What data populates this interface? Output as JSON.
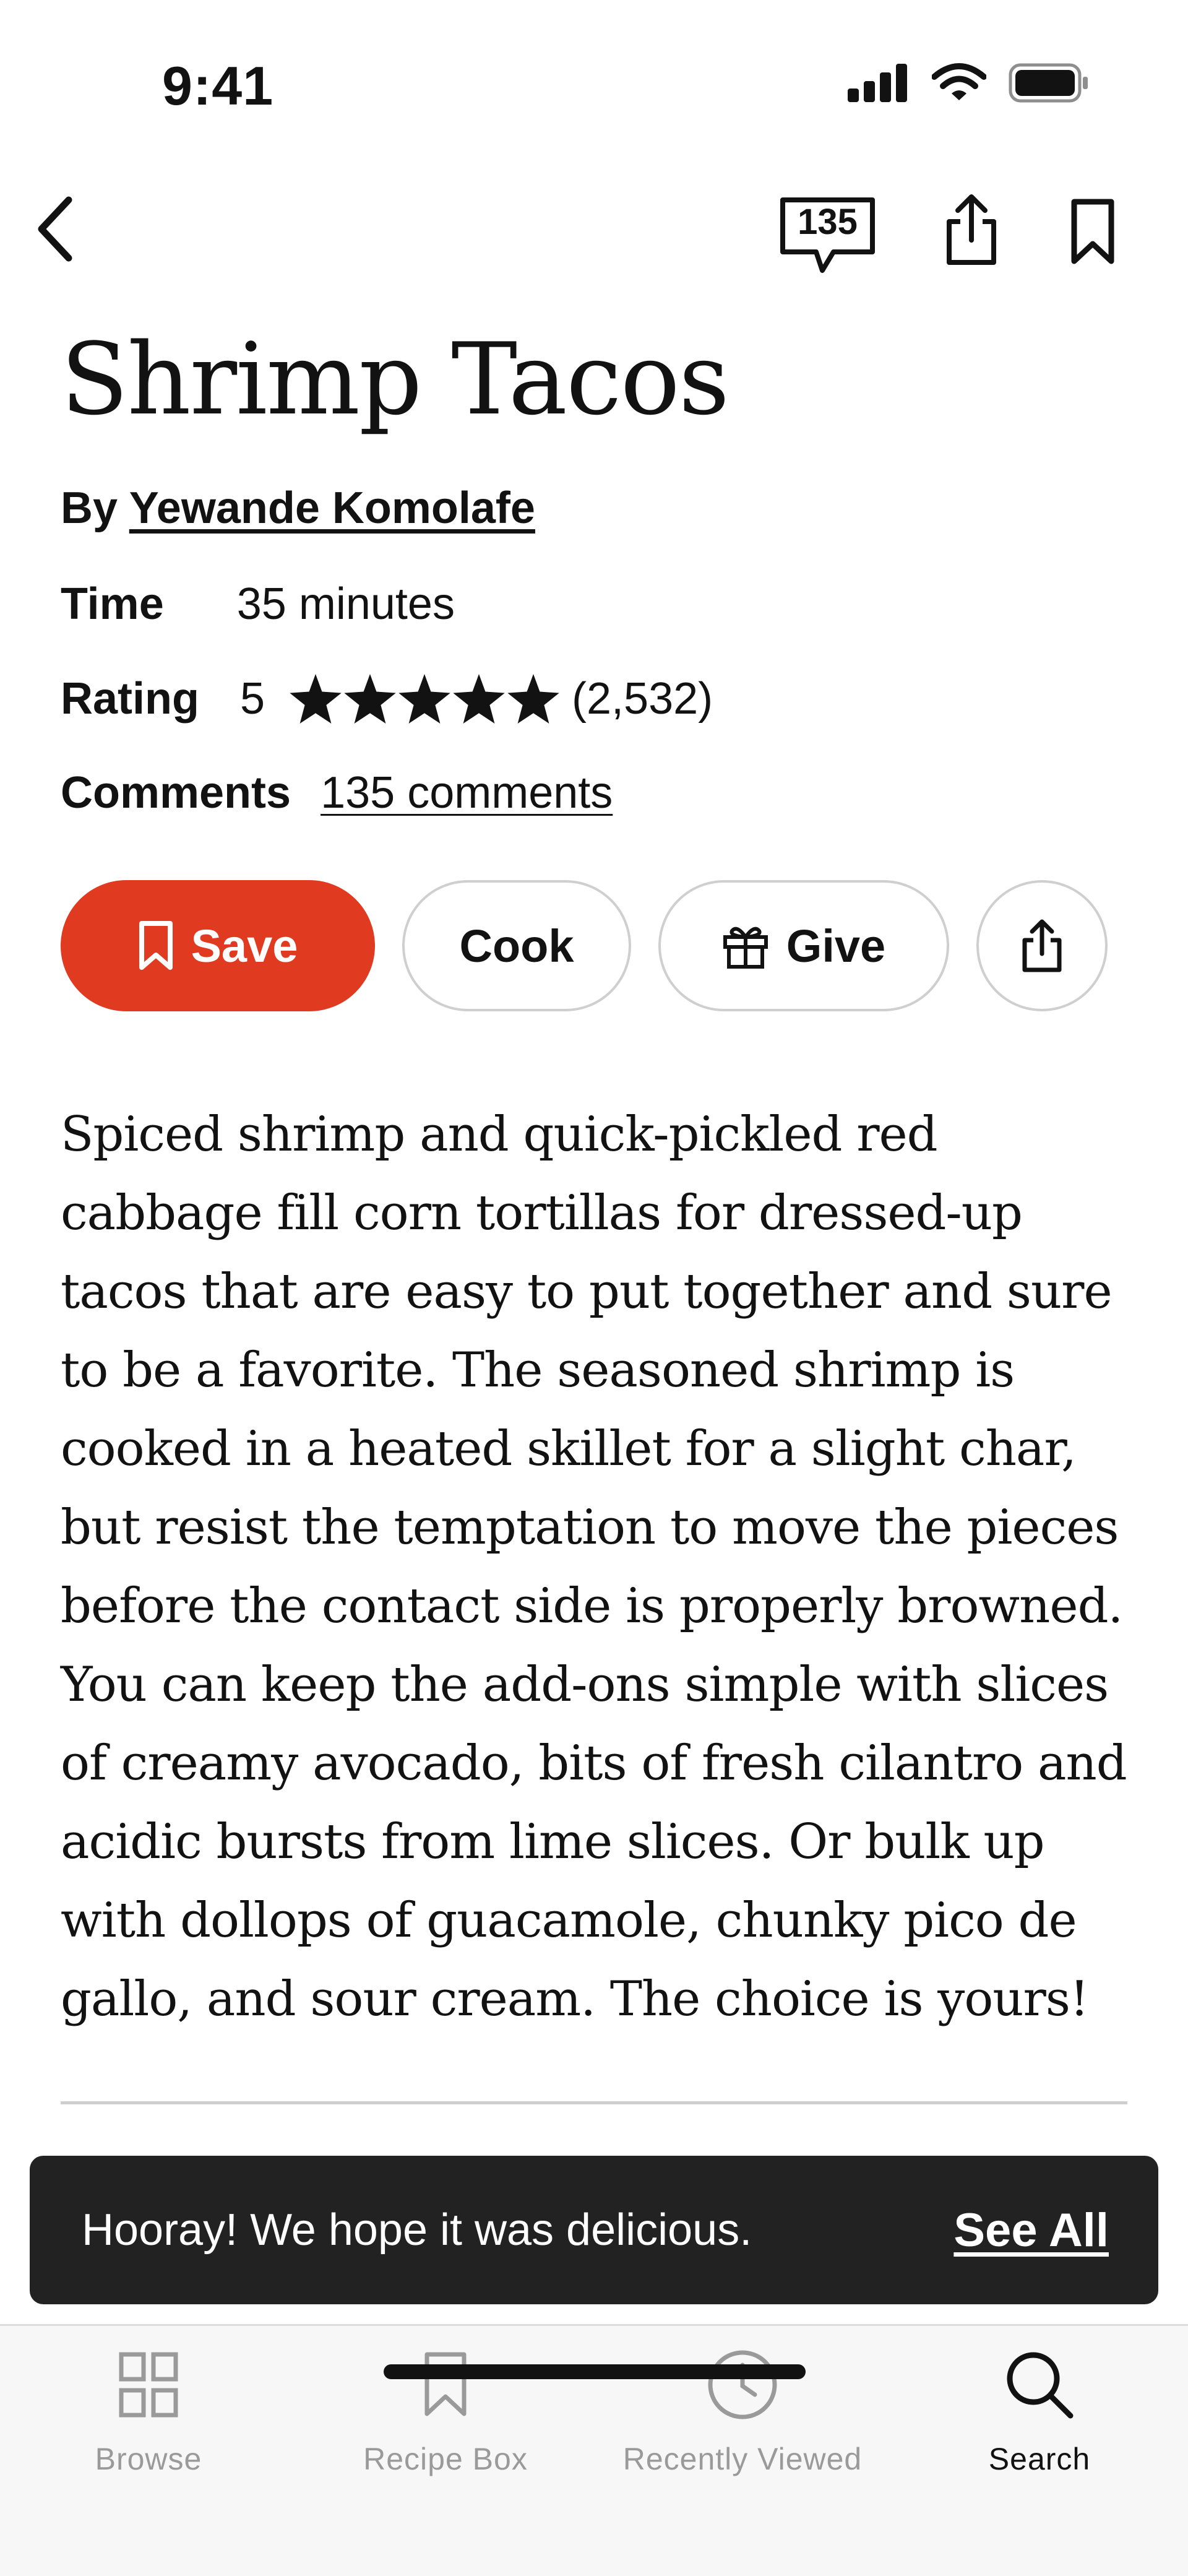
{
  "status_bar": {
    "time": "9:41"
  },
  "nav": {
    "comment_count": "135"
  },
  "recipe": {
    "title": "Shrimp Tacos",
    "byline_prefix": "By",
    "author": "Yewande Komolafe",
    "time_label": "Time",
    "time_value": "35 minutes",
    "rating_label": "Rating",
    "rating_value": "5",
    "rating_count": "(2,532)",
    "comments_label": "Comments",
    "comments_link": "135 comments",
    "description": "Spiced shrimp and quick-pickled red cabbage fill corn tortillas for dressed-up tacos that are easy to put together and sure to be a favorite. The seasoned shrimp is cooked in a heated skillet for a slight char, but resist the temptation to move the pieces before the contact side is properly browned. You can keep the add-ons simple with slices of creamy avocado, bits of fresh cilantro and acidic bursts from lime slices. Or bulk up with dollops of guacamole, chunky pico de gallo, and sour cream. The choice is yours!"
  },
  "actions": {
    "save": "Save",
    "cook": "Cook",
    "give": "Give"
  },
  "toast": {
    "message": "Hooray! We hope it was delicious.",
    "link": "See All"
  },
  "tabs": [
    {
      "label": "Browse",
      "icon": "grid-icon"
    },
    {
      "label": "Recipe Box",
      "icon": "bookmark-icon"
    },
    {
      "label": "Recently Viewed",
      "icon": "clock-icon"
    },
    {
      "label": "Search",
      "icon": "search-icon"
    }
  ],
  "colors": {
    "accent": "#e03a21",
    "toast_bg": "#222222",
    "text": "#121212",
    "muted": "#9a9a9a"
  }
}
